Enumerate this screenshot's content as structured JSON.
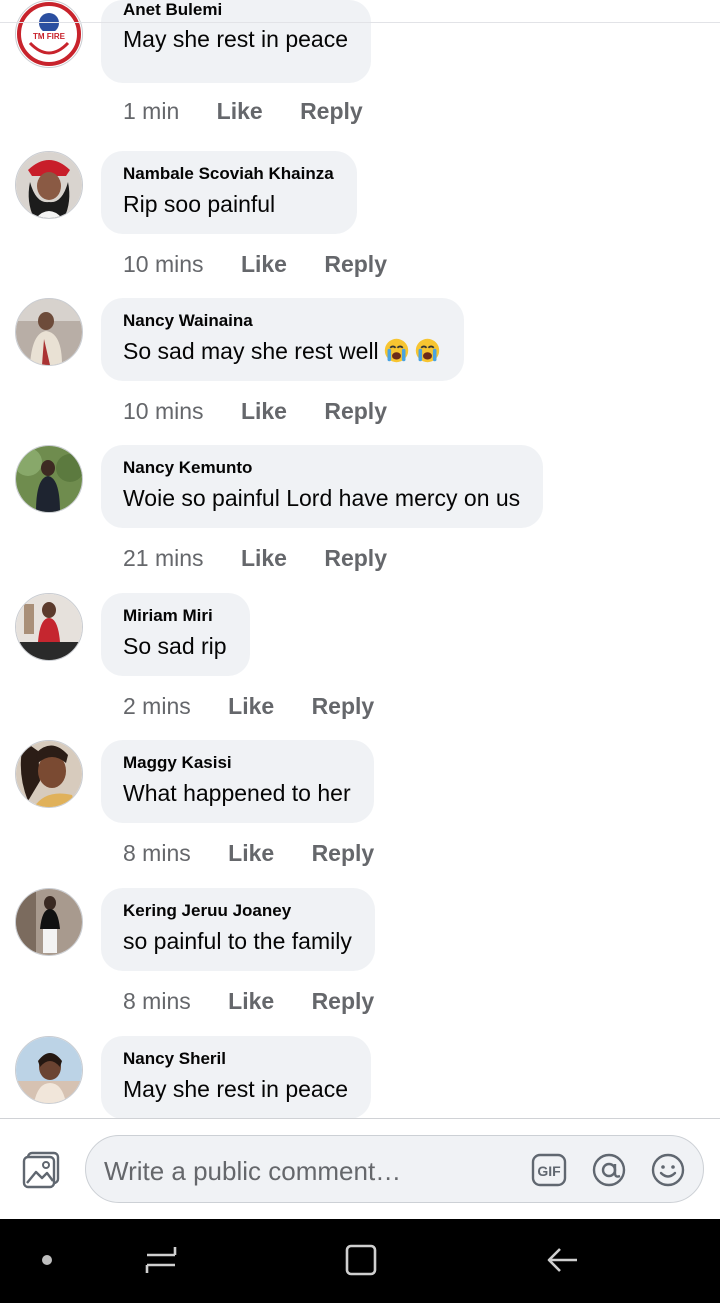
{
  "comments": [
    {
      "name": "Anet Bulemi",
      "text": "May she rest in peace",
      "time": "1 min",
      "like": "Like",
      "reply": "Reply"
    },
    {
      "name": "Nambale Scoviah Khainza",
      "text": "Rip soo painful",
      "time": "10 mins",
      "like": "Like",
      "reply": "Reply"
    },
    {
      "name": "Nancy Wainaina",
      "text": "So sad may she  rest well",
      "time": "10 mins",
      "like": "Like",
      "reply": "Reply"
    },
    {
      "name": "Nancy Kemunto",
      "text": "Woie so painful Lord have mercy on us",
      "time": "21 mins",
      "like": "Like",
      "reply": "Reply"
    },
    {
      "name": "Miriam Miri",
      "text": "So sad rip",
      "time": "2 mins",
      "like": "Like",
      "reply": "Reply"
    },
    {
      "name": "Maggy Kasisi",
      "text": "What happened to her",
      "time": "8 mins",
      "like": "Like",
      "reply": "Reply"
    },
    {
      "name": "Kering Jeruu Joaney",
      "text": "so painful to the family",
      "time": "8 mins",
      "like": "Like",
      "reply": "Reply"
    },
    {
      "name": "Nancy Sheril",
      "text": "May she rest in peace",
      "time": "",
      "like": "",
      "reply": ""
    }
  ],
  "avatar_logo_text": "TM FIRE",
  "composer": {
    "placeholder": "Write a public comment…",
    "gif_label": "GIF",
    "icons": [
      "photo-icon",
      "gif-icon",
      "mention-icon",
      "emoji-icon"
    ]
  },
  "navbar": {
    "icons": [
      "home-dot-icon",
      "recent-apps-icon",
      "overview-icon",
      "back-icon"
    ]
  },
  "colors": {
    "bubble": "#f0f2f5",
    "meta_text": "#65676b",
    "name_text": "#050505",
    "navbar": "#000000"
  }
}
